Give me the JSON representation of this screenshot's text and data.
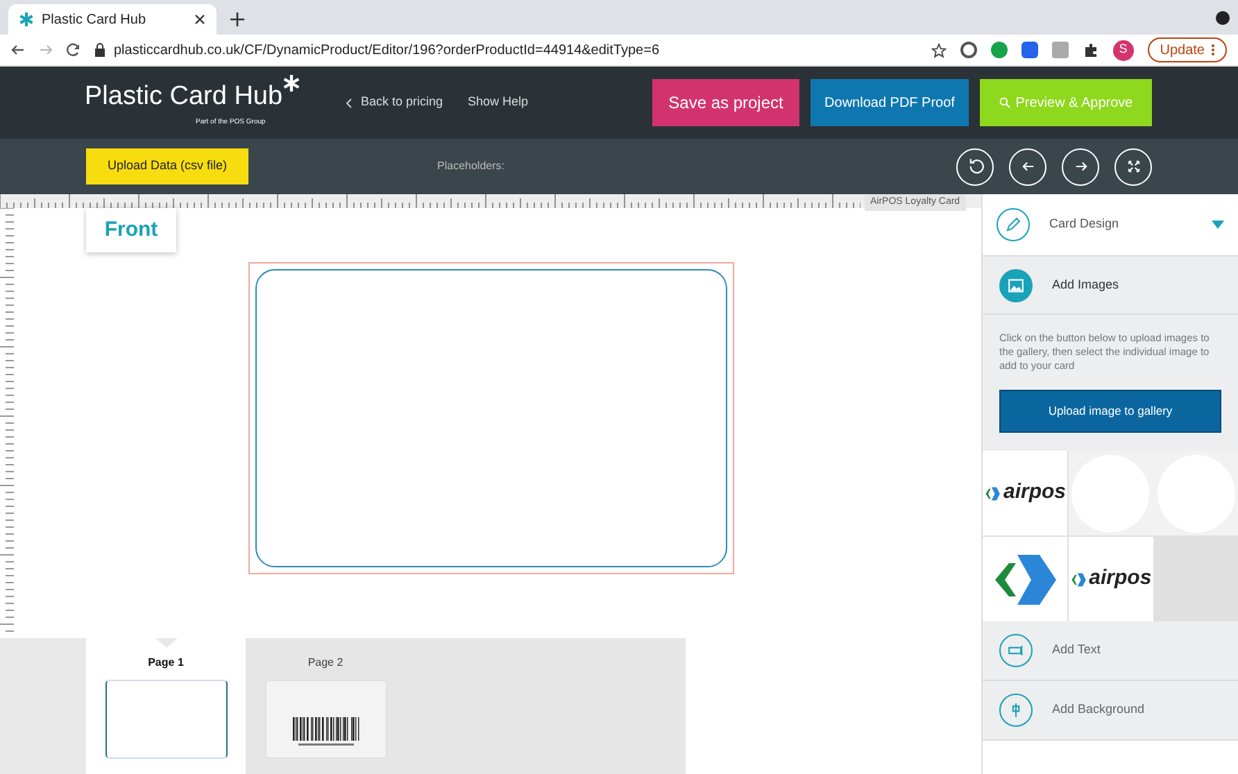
{
  "browser": {
    "tab_title": "Plastic Card Hub",
    "url": "plasticcardhub.co.uk/CF/DynamicProduct/Editor/196?orderProductId=44914&editType=6",
    "profile_initial": "S",
    "update_label": "Update"
  },
  "header": {
    "logo": "Plastic Card Hub",
    "logo_tagline": "Part of the POS Group",
    "back_link": "Back to pricing",
    "help_link": "Show Help",
    "buttons": [
      {
        "label": "Save as project",
        "kind": "save"
      },
      {
        "label": "Download PDF Proof",
        "kind": "download"
      },
      {
        "label": "Preview & Approve",
        "kind": "preview"
      }
    ]
  },
  "toolbar": {
    "upload_button": "Upload Data (csv file)",
    "placeholders_label": "Placeholders:"
  },
  "canvas": {
    "side_label": "Front",
    "card_name": "AirPOS Loyalty Card"
  },
  "pages": [
    {
      "label": "Page 1",
      "selected": true,
      "kind": "blank"
    },
    {
      "label": "Page 2",
      "selected": false,
      "kind": "barcode"
    }
  ],
  "panel": {
    "section": "Card Design",
    "expanded": true,
    "items": [
      {
        "label": "Add Images",
        "selected": true,
        "kind": "images"
      },
      {
        "label": "Add Text",
        "selected": false,
        "kind": "text"
      },
      {
        "label": "Add Background",
        "selected": false,
        "kind": "background"
      }
    ],
    "help_text": "Click on the button below to upload images to the gallery, then select the individual image to add to your card",
    "upload_button": "Upload image to gallery",
    "gallery": [
      {
        "kind": "wordmark",
        "text": "airpos"
      },
      {
        "kind": "blank"
      },
      {
        "kind": "blank"
      },
      {
        "kind": "chevron"
      },
      {
        "kind": "wordmark",
        "text": "airpos"
      }
    ]
  }
}
